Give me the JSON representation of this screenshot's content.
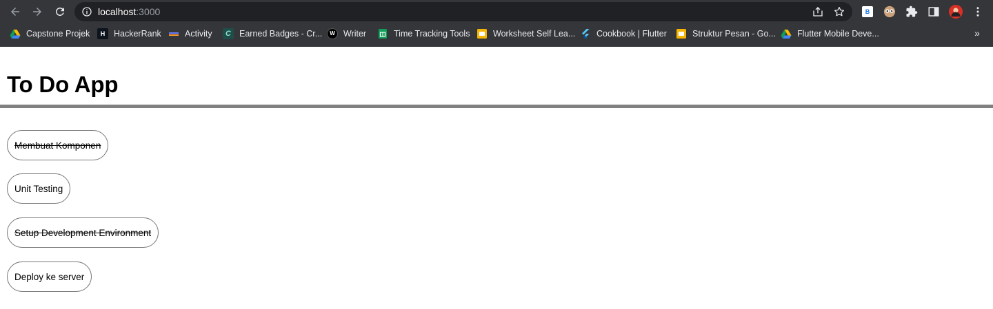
{
  "browser": {
    "url_host": "localhost",
    "url_port": ":3000",
    "extensions": [
      {
        "name": "b-extension",
        "label": "B"
      }
    ],
    "bookmarks": [
      {
        "label": "Capstone Projek",
        "icon": "google-drive-icon"
      },
      {
        "label": "HackerRank",
        "icon": "hackerrank-icon",
        "icon_text": "H"
      },
      {
        "label": "Activity",
        "icon": "activity-icon"
      },
      {
        "label": "Earned Badges - Cr...",
        "icon": "credly-icon",
        "icon_text": "C"
      },
      {
        "label": "Writer",
        "icon": "writer-icon",
        "icon_text": "W"
      },
      {
        "label": "Time Tracking Tools",
        "icon": "google-sheets-icon"
      },
      {
        "label": "Worksheet Self Lea...",
        "icon": "google-slides-icon"
      },
      {
        "label": "Cookbook | Flutter",
        "icon": "flutter-icon"
      },
      {
        "label": "Struktur Pesan - Go...",
        "icon": "google-slides-icon"
      },
      {
        "label": "Flutter Mobile Deve...",
        "icon": "google-drive-icon"
      }
    ],
    "more_label": "»"
  },
  "page": {
    "title": "To Do App",
    "todos": [
      {
        "text": "Membuat Komponen",
        "completed": true
      },
      {
        "text": "Unit Testing",
        "completed": false
      },
      {
        "text": "Setup Development Environment",
        "completed": true
      },
      {
        "text": "Deploy ke server",
        "completed": false
      }
    ]
  },
  "colors": {
    "chrome_bg": "#35363a",
    "omnibox_bg": "#202124",
    "rule": "#808080",
    "item_border": "#767676"
  }
}
